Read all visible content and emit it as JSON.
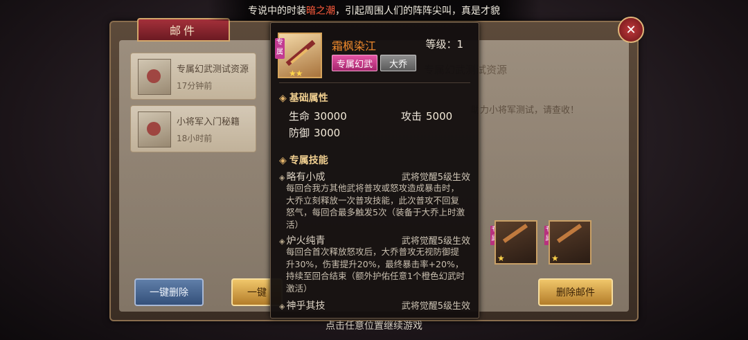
{
  "marquee": {
    "before": "专说中的时装",
    "highlight": "暗之潮",
    "after": "，引起周围人们的阵阵尖叫，真是才貌"
  },
  "mail_window": {
    "tab_title": "邮件",
    "close_icon": "close-x-icon",
    "items": [
      {
        "title": "专属幻武测试资源",
        "time": "17分钟前"
      },
      {
        "title": "小将军入门秘籍",
        "time": "18小时前"
      }
    ],
    "detail_title": "专属幻武测试资源",
    "detail_body": "助力小将军测试，请查收！",
    "btn_delete_all": "一键删除",
    "btn_collect_all": "一键",
    "btn_delete_mail": "删除邮件"
  },
  "tooltip": {
    "item_name": "霜枫染江",
    "level": "等级：1",
    "exclusive_badge": "专属",
    "tags": [
      "专属幻武",
      "大乔"
    ],
    "base_title": "基础属性",
    "attrs": {
      "hp_label": "生命",
      "hp_value": "30000",
      "atk_label": "攻击",
      "atk_value": "5000",
      "def_label": "防御",
      "def_value": "3000"
    },
    "skill_section_title": "专属技能",
    "skills": [
      {
        "name": "略有小成",
        "condition": "武将觉醒5级生效",
        "desc": "每回合我方其他武将普攻或怒攻造成暴击时，大乔立刻释放一次普攻技能，此次普攻不回复怒气，每回合最多触发5次（装备于大乔上时激活）"
      },
      {
        "name": "炉火纯青",
        "condition": "武将觉醒5级生效",
        "desc": "每回合首次释放怒攻后，大乔普攻无视防御提升30%，伤害提升20%，最终暴击率+20%，持续至回合结束（额外护佑任意1个橙色幻武时激活）"
      },
      {
        "name": "神乎其技",
        "condition": "武将觉醒5级生效"
      }
    ]
  },
  "bottom_hint": "点击任意位置继续游戏",
  "colors": {
    "item_name": "#f08a2c",
    "marquee_highlight": "#ff5b3c",
    "section_title": "#f0cf90",
    "tag_pink": "#c23b92"
  }
}
